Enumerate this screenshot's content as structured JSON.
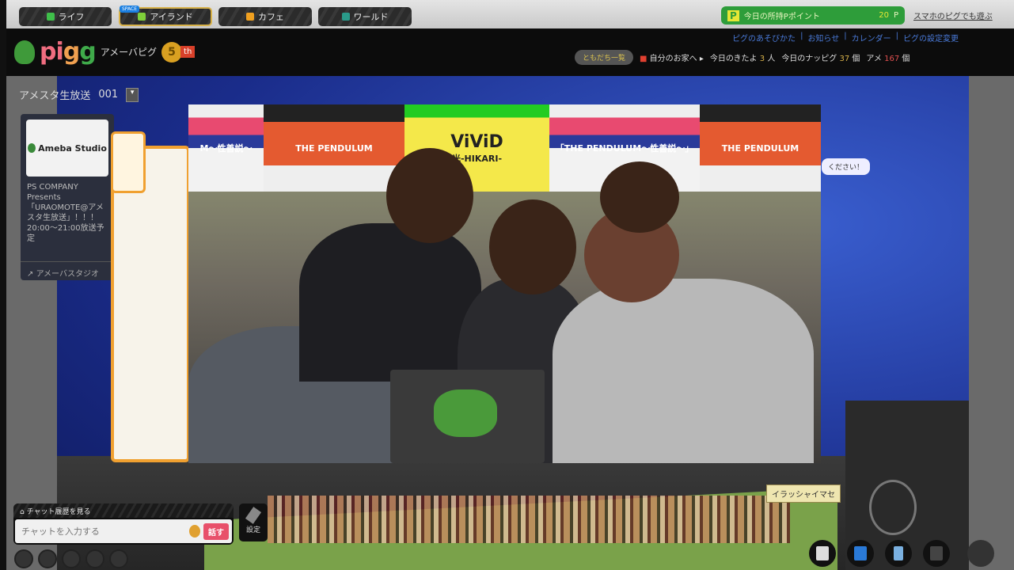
{
  "topnav": {
    "tabs": [
      {
        "label": "ライフ",
        "color": "#3fbf4a"
      },
      {
        "label": "アイランド",
        "color": "#7fcf3a",
        "badge": "SPACE"
      },
      {
        "label": "カフェ",
        "color": "#f0a020"
      },
      {
        "label": "ワールド",
        "color": "#2a9a8a"
      }
    ],
    "points_label": "今日の所持Pポイント",
    "points_value": "20",
    "points_unit": "P",
    "smartphone_link": "スマホのピグでも遊ぶ"
  },
  "header": {
    "logo": "pigg",
    "logo_sub": "アメーバピグ",
    "anniversary": "5",
    "anniversary_suffix": "th",
    "links": [
      "ピグのあそびかた",
      "お知らせ",
      "カレンダー",
      "ピグの設定変更"
    ],
    "friends_button": "ともだち一覧",
    "home": "自分のお家へ",
    "visits_label": "今日のきたよ",
    "visits_value": "3",
    "visits_unit": "人",
    "nappig_label": "今日のナッピグ",
    "nappig_value": "37",
    "nappig_unit": "個",
    "ame_label": "アメ",
    "ame_value": "167",
    "ame_unit": "個"
  },
  "room": {
    "title": "アメスタ生放送",
    "number": "001",
    "dropdown": "▾"
  },
  "infocard": {
    "logo": "Ameba Studio",
    "description": "PS COMPANY Presents「URAOMOTE@アメスタ生放送」！！！20:00〜21:00放送予定",
    "link": "アメーバスタジオ"
  },
  "video": {
    "posters": [
      {
        "title": "M〜性善説〜"
      },
      {
        "title": "THE PENDULUM"
      },
      {
        "title": "ViViD",
        "subtitle": "光-HIKARI-"
      },
      {
        "title": "「THE PENDULUM〜性善説〜」"
      },
      {
        "title": "THE PENDULUM"
      }
    ]
  },
  "notice": "ください！",
  "bubble": "イラッシャイマセ",
  "chat": {
    "history": "チャット履歴を見る",
    "placeholder": "チャットを入力する",
    "send": "話す",
    "settings": "設定"
  }
}
